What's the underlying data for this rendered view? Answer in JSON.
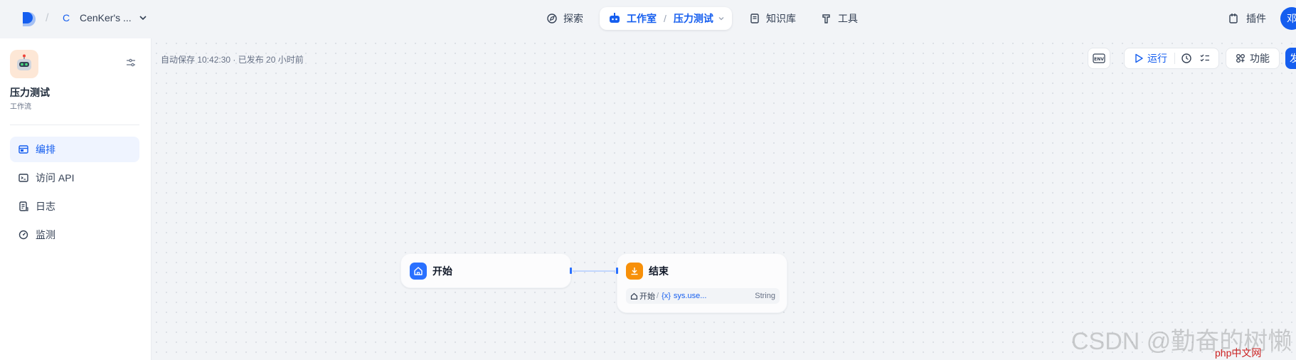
{
  "topbar": {
    "workspace_initial": "C",
    "workspace_name": "CenKer's ...",
    "nav_explore": "探索",
    "nav_studio": "工作室",
    "nav_app": "压力测试",
    "nav_knowledge": "知识库",
    "nav_tools": "工具",
    "plugin": "插件",
    "user_initial": "邓"
  },
  "sidebar": {
    "app_name": "压力测试",
    "app_type": "工作流",
    "items": [
      {
        "label": "编排",
        "icon": "layout-icon",
        "active": true
      },
      {
        "label": "访问 API",
        "icon": "terminal-icon",
        "active": false
      },
      {
        "label": "日志",
        "icon": "document-icon",
        "active": false
      },
      {
        "label": "监测",
        "icon": "gauge-icon",
        "active": false
      }
    ]
  },
  "canvas": {
    "autosave": "自动保存 10:42:30 · 已发布 20 小时前",
    "env_label": "ENV",
    "run_label": "运行",
    "features_label": "功能",
    "publish_label": "发"
  },
  "nodes": {
    "start": {
      "title": "开始",
      "icon": "home-icon",
      "color": "#2970ff"
    },
    "end": {
      "title": "结束",
      "icon": "flag-icon",
      "color": "#f79009",
      "var_source": "开始",
      "var_prefix": "{x}",
      "var_name": "sys.use...",
      "var_type": "String"
    }
  },
  "watermark": {
    "text": "CSDN @勤奋的树懒",
    "site": "php中文网"
  },
  "colors": {
    "accent": "#155eef",
    "start_node": "#2970ff",
    "end_node": "#f79009",
    "background": "#f2f4f7"
  }
}
